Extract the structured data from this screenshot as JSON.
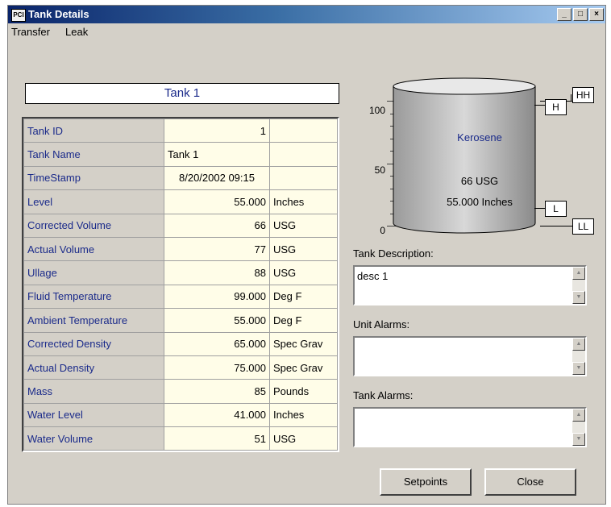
{
  "window": {
    "icon_text": "PCI",
    "title": "Tank Details",
    "minimize": "_",
    "maximize": "□",
    "close": "×"
  },
  "menu": [
    "Transfer",
    "Leak"
  ],
  "tank_title": "Tank 1",
  "rows": [
    {
      "label": "Tank ID",
      "value": "1",
      "unit": ""
    },
    {
      "label": "Tank Name",
      "value": "Tank 1",
      "unit": ""
    },
    {
      "label": "TimeStamp",
      "value": "8/20/2002 09:15",
      "unit": ""
    },
    {
      "label": "Level",
      "value": "55.000",
      "unit": "Inches"
    },
    {
      "label": "Corrected Volume",
      "value": "66",
      "unit": "USG"
    },
    {
      "label": "Actual Volume",
      "value": "77",
      "unit": "USG"
    },
    {
      "label": "Ullage",
      "value": "88",
      "unit": "USG"
    },
    {
      "label": "Fluid Temperature",
      "value": "99.000",
      "unit": "Deg F"
    },
    {
      "label": "Ambient Temperature",
      "value": "55.000",
      "unit": "Deg F"
    },
    {
      "label": "Corrected Density",
      "value": "65.000",
      "unit": "Spec Grav"
    },
    {
      "label": "Actual Density",
      "value": "75.000",
      "unit": "Spec Grav"
    },
    {
      "label": "Mass",
      "value": "85",
      "unit": "Pounds"
    },
    {
      "label": "Water Level",
      "value": "41.000",
      "unit": "Inches"
    },
    {
      "label": "Water Volume",
      "value": "51",
      "unit": "USG"
    }
  ],
  "gauge": {
    "scale_labels": [
      "100",
      "50",
      "0"
    ],
    "fill_percent": 55,
    "fill_color": "#7ee07e",
    "empty_color": "#000000",
    "product": "Kerosene",
    "volume_text": "66 USG",
    "level_text": "55.000 Inches",
    "alarms": {
      "hh": "HH",
      "h": "H",
      "l": "L",
      "ll": "LL"
    }
  },
  "tank_description": {
    "label": "Tank Description:",
    "value": "desc 1"
  },
  "unit_alarms": {
    "label": "Unit Alarms:",
    "value": ""
  },
  "tank_alarms": {
    "label": "Tank Alarms:",
    "value": ""
  },
  "buttons": {
    "setpoints": "Setpoints",
    "close": "Close"
  },
  "colors": {
    "accent_text": "#1a2a8a",
    "value_bg": "#fffde8"
  }
}
